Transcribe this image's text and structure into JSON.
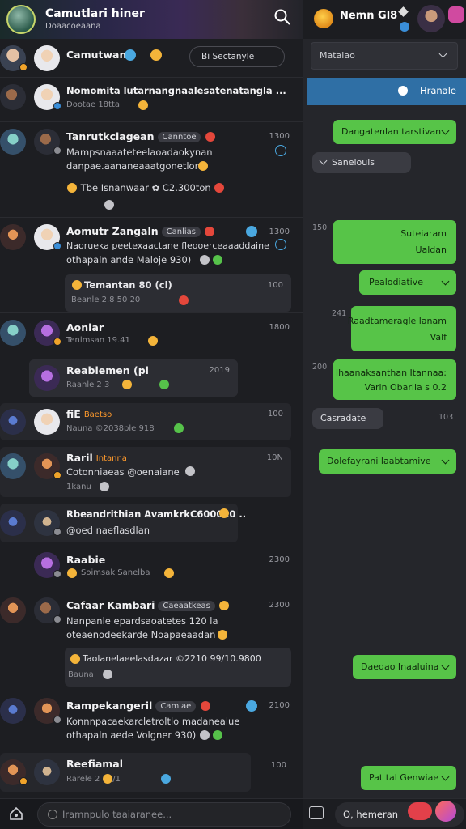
{
  "left_header": {
    "app_title": "Camutlari hiner",
    "app_subtitle": "Doaacoeaana",
    "search_icon": "search-icon"
  },
  "feed": [
    {
      "name": "Camutwan",
      "time": "",
      "search_label": "Bi Sectanyle"
    },
    {
      "name": "Nomomita lutarnangnaalesatenatangla ...",
      "meta": "Dootae 18tta"
    },
    {
      "name": "Tanrutkclagean",
      "tag": "Canntoe",
      "time": "1300",
      "text1": "Mampsnaaateteelaoadaokynan",
      "text2": "danpae.aananeaaatgonetlon",
      "reply": "Tbe Isnanwaar ✿ C2.300ton"
    },
    {
      "name": "Aomutr Zangaln",
      "tag": "Canlias",
      "time": "1300",
      "text1": "Naorueka peetexaactane fleooerceaaaddaine",
      "text2": "othapaln ande Maloje 930)",
      "quote_title": "Temantan 80 (cl)",
      "quote_meta": "Beanle  2.8  50 20",
      "quote_time": "100"
    },
    {
      "name": "Aonlar",
      "time": "1800",
      "meta": "Tenlmsan  19.41"
    },
    {
      "name": "Reablemen (pl",
      "time": "2019",
      "meta": "Raanle  2  3"
    },
    {
      "name": "fiE",
      "tag": "Baetso",
      "time": "100",
      "meta": "Nauna  ©2038ple 918"
    },
    {
      "name": "Raril",
      "tag": "Intanna",
      "time": "10N",
      "text1": "Cotonniaeas @oenaiane",
      "meta": "1kanu"
    },
    {
      "name": "Rbeandrithian AvamkrkC600010 ..",
      "text1": "@oed naeflasdlan"
    },
    {
      "name": "Raabie",
      "time": "2300",
      "meta": "Soimsak Sanelba"
    },
    {
      "name": "Cafaar Kambari",
      "tag": "Caeaatkeas",
      "time": "2300",
      "text1": "Nanpanle epardsaoatetes 120 la",
      "text2": "oteaenodeekarde Noapaeaadan",
      "reply": "Taolanelaeelasdazar  ©2210  99/10.9800",
      "reply_meta": "Bauna"
    },
    {
      "name": "Rampekangeril",
      "tag": "Camiae",
      "time": "2100",
      "text1": "Konnnpacaekarcletroltlo madanealue",
      "text2": "othapaln aede Volgner 930)"
    },
    {
      "name": "Reefiamal",
      "time": "100",
      "meta": "Rarele  2  1S/1"
    }
  ],
  "left_footer": {
    "placeholder": "Iramnpulo taaiaranee..."
  },
  "right_header": {
    "title": "Nemn Gl8"
  },
  "right": {
    "dropdown_label": "Matalao",
    "notice": "Hranale",
    "messages": [
      {
        "label": "Dangatenlan tarstivan"
      },
      {
        "label": "Sanelouls"
      },
      {
        "time": "150",
        "label_line1": "Suteiaram",
        "label_line2": "Ualdan"
      },
      {
        "label": "Pealodiative"
      },
      {
        "time": "241",
        "label_line1": "Raadtameragle lanam",
        "label_line2": "Valf"
      },
      {
        "time": "200",
        "label_line1": "Ihaanaksanthan Itannaa:",
        "label_line2": "Varin Obarlia s 0.2"
      },
      {
        "label": "Casradate",
        "time": "103"
      },
      {
        "label": "Dolefayrani laabtamive"
      },
      {
        "label": "Daedao Inaaluina"
      },
      {
        "label": "Pat tal Genwiae"
      }
    ]
  },
  "right_footer": {
    "placeholder": "O, hemeran"
  }
}
